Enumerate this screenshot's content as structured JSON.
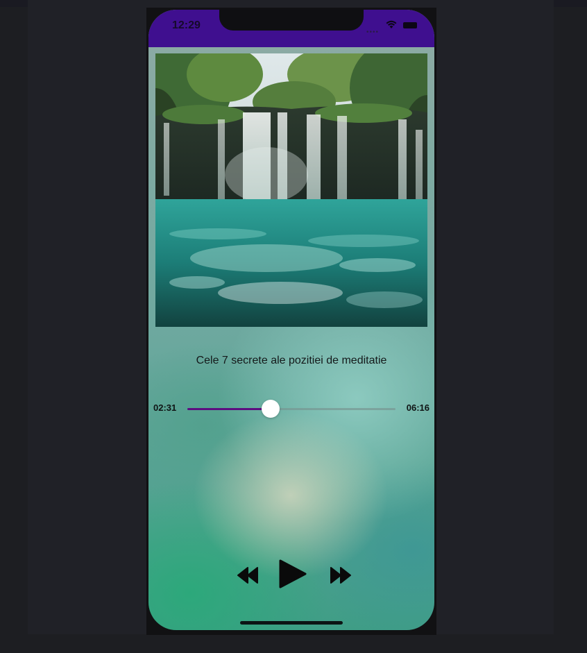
{
  "status_bar": {
    "time": "12:29",
    "background_color": "#3f0f8f"
  },
  "player": {
    "track_title": "Cele 7 secrete ale pozitiei de meditatie",
    "elapsed_time": "02:31",
    "total_time": "06:16",
    "progress_fraction": 0.4,
    "accent_color": "#5c0e80",
    "artwork_icon": "waterfall-lake-image",
    "controls": {
      "rewind_icon": "rewind-icon",
      "play_icon": "play-icon",
      "forward_icon": "fast-forward-icon"
    }
  }
}
